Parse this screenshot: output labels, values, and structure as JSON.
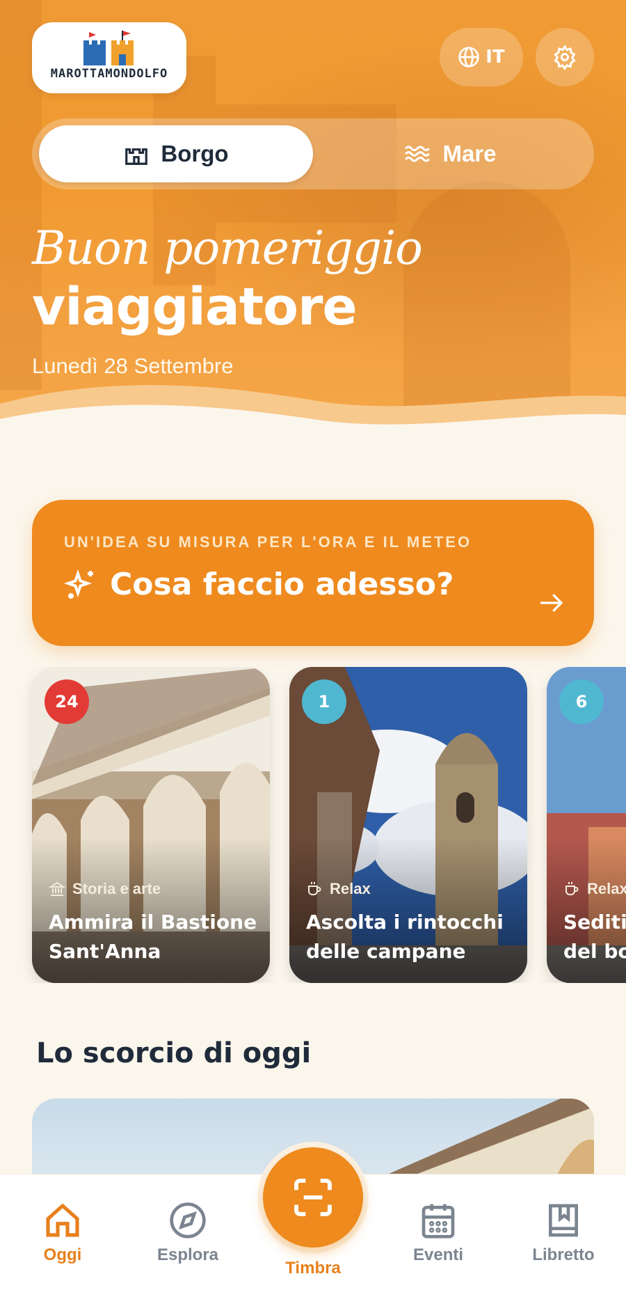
{
  "header": {
    "logo_text": "MAROTTAMONDOLFO",
    "language_label": "IT",
    "icons": {
      "language": "globe-icon",
      "settings": "gear-icon"
    }
  },
  "segment": {
    "options": [
      {
        "label": "Borgo",
        "icon": "castle-icon",
        "selected": true
      },
      {
        "label": "Mare",
        "icon": "waves-icon",
        "selected": false
      }
    ]
  },
  "greeting": {
    "line1": "Buon pomeriggio",
    "line2": "viaggiatore",
    "date": "Lunedì 28 Settembre"
  },
  "cta": {
    "kicker": "UN'IDEA SU MISURA PER L'ORA E IL METEO",
    "title": "Cosa faccio adesso?",
    "icons": {
      "sparkle": "sparkles-icon",
      "arrow": "arrow-right-icon"
    }
  },
  "cards": [
    {
      "badge": "24",
      "badge_color": "#e23a35",
      "category": "Storia e arte",
      "category_icon": "museum-icon",
      "title_line1": "Ammira il Bastione",
      "title_line2": "Sant'Anna"
    },
    {
      "badge": "1",
      "badge_color": "#4fb8d0",
      "category": "Relax",
      "category_icon": "coffee-cup-icon",
      "title_line1": "Ascolta i rintocchi",
      "title_line2": "delle campane"
    },
    {
      "badge": "6",
      "badge_color": "#4fb8d0",
      "category": "Relax",
      "category_icon": "coffee-cup-icon",
      "title_line1": "Sediti",
      "title_line2": "del bo"
    }
  ],
  "section": {
    "title": "Lo scorcio di oggi"
  },
  "nav": {
    "items": [
      {
        "label": "Oggi",
        "icon": "home-icon",
        "active": true
      },
      {
        "label": "Esplora",
        "icon": "compass-icon",
        "active": false
      },
      {
        "label": "Timbra",
        "icon": "scan-icon",
        "active": true
      },
      {
        "label": "Eventi",
        "icon": "calendar-icon",
        "active": false
      },
      {
        "label": "Libretto",
        "icon": "book-bookmark-icon",
        "active": false
      }
    ]
  },
  "colors": {
    "accent": "#ee8a1e",
    "hero": "#f19a30",
    "text_dark": "#1f2b3a",
    "background": "#fbf6ec",
    "nav_inactive": "#7b8590"
  }
}
